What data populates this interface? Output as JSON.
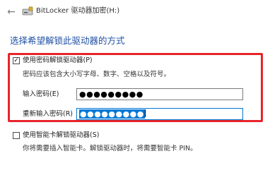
{
  "window": {
    "title": "BitLocker 驱动器加密(H:)",
    "back_glyph": "←"
  },
  "main": {
    "heading": "选择希望解锁此驱动器的方式",
    "password_option": {
      "label": "使用密码解锁驱动器(P)",
      "checked": true,
      "check_glyph": "✓",
      "description": "密码应该包含大小写字母、数字、空格以及符号。",
      "password_field": {
        "label": "输入密码(E)",
        "value": "●●●●●●●●●"
      },
      "confirm_field": {
        "label": "重新输入密码(R)",
        "value": "●●●●●●●●●"
      }
    },
    "smartcard_option": {
      "label": "使用智能卡解锁驱动器(S)",
      "checked": false,
      "description": "你将需要插入智能卡。解锁驱动器时，将需要智能卡 PIN。"
    }
  },
  "colors": {
    "heading": "#1e4fa3",
    "highlight_border": "#e7242b",
    "selection": "#0078d7"
  }
}
